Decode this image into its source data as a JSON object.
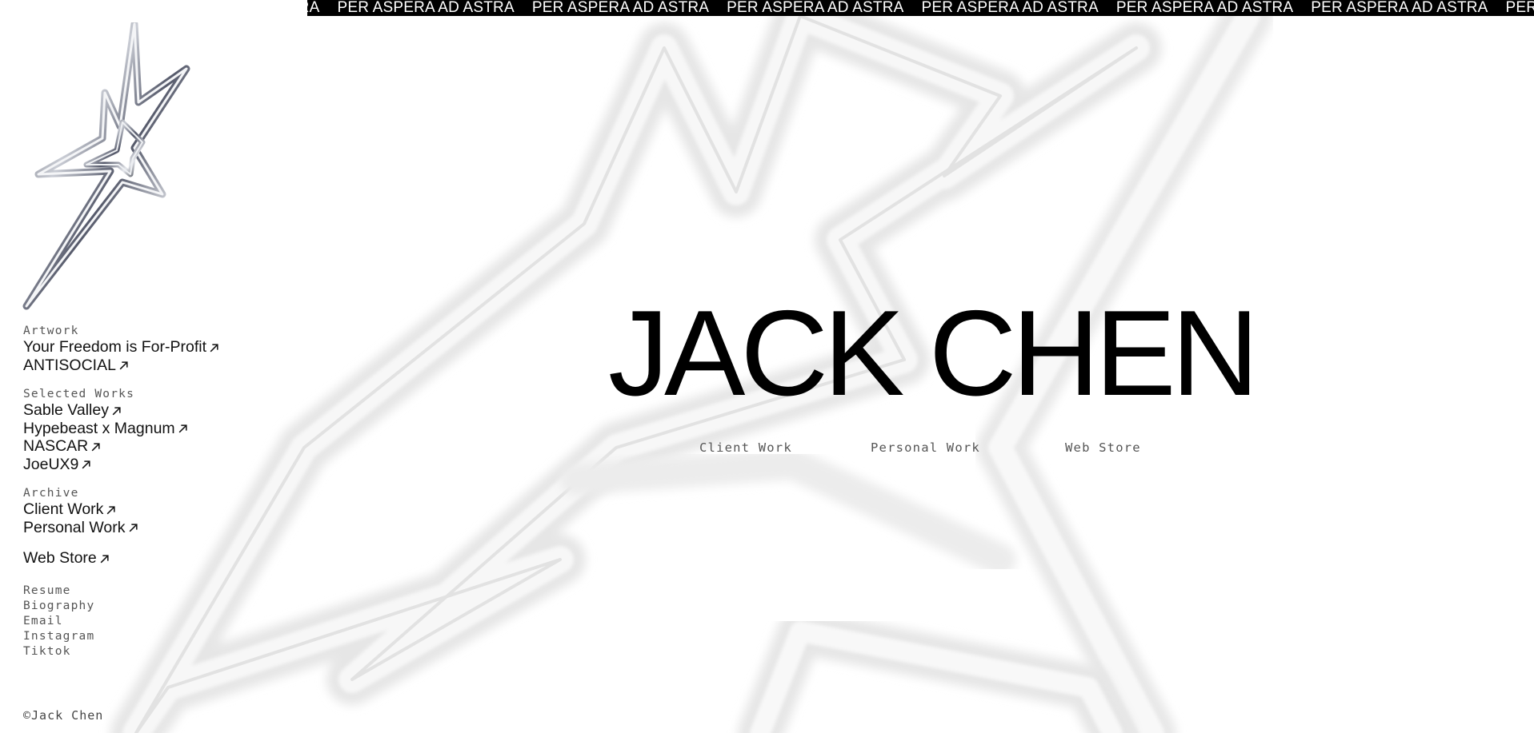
{
  "marquee": {
    "lead_fragment": "STRA",
    "items": [
      "PER ASPERA AD ASTRA",
      "PER ASPERA AD ASTRA",
      "PER ASPERA AD ASTRA",
      "PER ASPERA AD ASTRA",
      "PER ASPERA AD ASTRA",
      "PER ASPERA AD ASTRA",
      "PER ASPERA AD ASTRA"
    ]
  },
  "sidebar": {
    "artwork": {
      "label": "Artwork",
      "links": [
        "Your Freedom is For-Profit",
        "ANTISOCIAL"
      ]
    },
    "selected_works": {
      "label": "Selected Works",
      "links": [
        "Sable Valley",
        "Hypebeast x Magnum",
        "NASCAR",
        "JoeUX9"
      ]
    },
    "archive": {
      "label": "Archive",
      "links": [
        "Client Work",
        "Personal Work"
      ]
    },
    "web_store": "Web Store",
    "info_links": [
      "Resume",
      "Biography",
      "Email",
      "Instagram",
      "Tiktok"
    ],
    "copyright": "©Jack Chen"
  },
  "hero": {
    "title": "JACK CHEN",
    "nav": [
      "Client Work",
      "Personal Work",
      "Web Store"
    ]
  },
  "colors": {
    "marquee_bg": "#000000",
    "marquee_text": "#ffffff",
    "chrome_highlight": "#f2f2f2",
    "chrome_shadow": "#c9c9c9"
  },
  "icons": {
    "logo": "chrome-star-logo-icon",
    "link_arrow": "arrow-up-right-icon",
    "background": "chrome-star-background"
  }
}
